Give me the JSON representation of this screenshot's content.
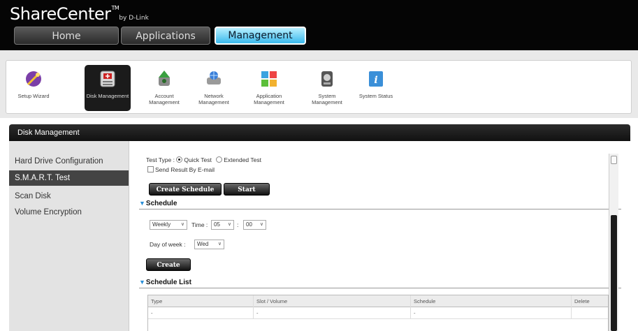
{
  "brand": {
    "name": "ShareCenter",
    "tm": "TM",
    "by": "by D-Link"
  },
  "nav_tabs": [
    "Home",
    "Applications",
    "Management"
  ],
  "toolbar": [
    {
      "label": "Setup Wizard",
      "icon": "wizard-icon"
    },
    {
      "label": "Disk Management",
      "icon": "disk-management-icon"
    },
    {
      "label": "Account Management",
      "icon": "account-management-icon"
    },
    {
      "label": "Network Management",
      "icon": "network-management-icon"
    },
    {
      "label": "Application Management",
      "icon": "application-management-icon"
    },
    {
      "label": "System Management",
      "icon": "system-management-icon"
    },
    {
      "label": "System Status",
      "icon": "system-status-icon"
    }
  ],
  "section_title": "Disk Management",
  "sidebar": {
    "items": [
      "Hard Drive Configuration",
      "S.M.A.R.T. Test",
      "Scan Disk",
      "Volume Encryption"
    ],
    "selected": "S.M.A.R.T. Test"
  },
  "test": {
    "type_label": "Test Type :",
    "quick": "Quick Test",
    "extended": "Extended Test",
    "email_label": "Send Result By E-mail",
    "create_schedule_btn": "Create Schedule",
    "start_btn": "Start"
  },
  "schedule": {
    "title": "Schedule",
    "frequency": "Weekly",
    "time_label": "Time :",
    "hour": "05",
    "minute": "00",
    "colon": ":",
    "day_label": "Day of week :",
    "day": "Wed",
    "create_btn": "Create"
  },
  "schedule_list": {
    "title": "Schedule List",
    "columns": [
      "Type",
      "Slot / Volume",
      "Schedule",
      "Delete"
    ],
    "rows": [
      [
        "-",
        "-",
        "-",
        ""
      ]
    ]
  },
  "colors": {
    "accent": "#39b8ec",
    "dark": "#111111",
    "sidebar": "#e3e3e3"
  }
}
